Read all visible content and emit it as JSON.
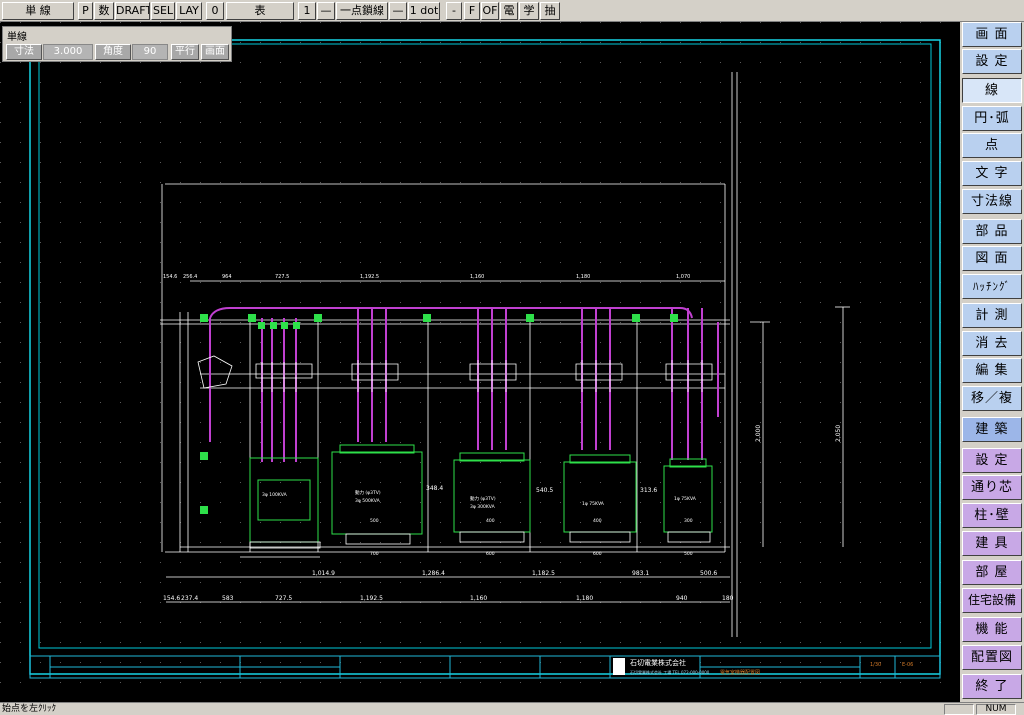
{
  "toolbar": {
    "items": [
      {
        "label": "単  線",
        "name": "line-type-button"
      },
      {
        "label": "P",
        "name": "p-button"
      },
      {
        "label": "数",
        "name": "number-button"
      },
      {
        "label": "DRAFT",
        "name": "draft-button"
      },
      {
        "label": "SEL",
        "name": "sel-button"
      },
      {
        "label": "LAY",
        "name": "layer-button"
      },
      {
        "label": "0",
        "name": "layer-number-button"
      },
      {
        "label": "表",
        "name": "table-button"
      },
      {
        "label": "1",
        "name": "line-number-button"
      },
      {
        "label": "—",
        "name": "line-sample-button"
      },
      {
        "label": "一点鎖線",
        "name": "linetype-button"
      },
      {
        "label": "—",
        "name": "line-width-sample-button"
      },
      {
        "label": "1 dot",
        "name": "line-width-button"
      },
      {
        "label": "-",
        "name": "minus-button"
      },
      {
        "label": "F",
        "name": "f-button"
      },
      {
        "label": "OF",
        "name": "of-button"
      },
      {
        "label": "電",
        "name": "electric-button"
      },
      {
        "label": "学",
        "name": "learn-button"
      },
      {
        "label": "抽",
        "name": "extract-button"
      }
    ]
  },
  "panel": {
    "title": "単線",
    "size_label": "寸法",
    "size_value": "3.000",
    "angle_label": "角度",
    "angle_value": "90",
    "parallel_label": "平行",
    "screen_label": "画面"
  },
  "menu": {
    "items": [
      {
        "label": "画 面",
        "name": "menu-screen",
        "style": "normal"
      },
      {
        "label": "設 定",
        "name": "menu-settings",
        "style": "normal"
      },
      {
        "label": "線",
        "name": "menu-line",
        "style": "active"
      },
      {
        "label": "円･弧",
        "name": "menu-circle-arc",
        "style": "normal"
      },
      {
        "label": "点",
        "name": "menu-point",
        "style": "normal"
      },
      {
        "label": "文 字",
        "name": "menu-text",
        "style": "normal"
      },
      {
        "label": "寸法線",
        "name": "menu-dimension",
        "style": "normal"
      },
      {
        "label": "部 品",
        "name": "menu-parts",
        "style": "normal"
      },
      {
        "label": "図 面",
        "name": "menu-drawing",
        "style": "normal"
      },
      {
        "label": "ﾊｯﾁﾝｸﾞ",
        "name": "menu-hatching",
        "style": "normal"
      },
      {
        "label": "計 測",
        "name": "menu-measure",
        "style": "normal"
      },
      {
        "label": "消 去",
        "name": "menu-erase",
        "style": "normal"
      },
      {
        "label": "編 集",
        "name": "menu-edit",
        "style": "normal"
      },
      {
        "label": "移／複",
        "name": "menu-move-copy",
        "style": "normal"
      },
      {
        "label": "建 築",
        "name": "menu-architecture",
        "style": "section"
      },
      {
        "label": "設 定",
        "name": "menu-arch-settings",
        "style": "arch"
      },
      {
        "label": "通り芯",
        "name": "menu-grid-lines",
        "style": "arch"
      },
      {
        "label": "柱･壁",
        "name": "menu-column-wall",
        "style": "arch"
      },
      {
        "label": "建 具",
        "name": "menu-fittings",
        "style": "arch"
      },
      {
        "label": "部 屋",
        "name": "menu-room",
        "style": "arch"
      },
      {
        "label": "住宅設備",
        "name": "menu-housing-equipment",
        "style": "arch"
      },
      {
        "label": "機 能",
        "name": "menu-function",
        "style": "arch"
      },
      {
        "label": "配置図",
        "name": "menu-layout",
        "style": "arch"
      },
      {
        "label": "終 了",
        "name": "menu-exit",
        "style": "arch"
      }
    ]
  },
  "drawing": {
    "dims_top": [
      "154.6",
      "256.4",
      "964",
      "727.5",
      "1,192.5",
      "1,160",
      "1,180",
      "1,070"
    ],
    "dims_mid": [
      "1,014.9",
      "1,286.4",
      "1,182.5",
      "983.1",
      "500.6"
    ],
    "dims_bottom": [
      "154.6",
      "237.4",
      "583",
      "727.5",
      "1,192.5",
      "1,160",
      "1,180",
      "940",
      "180"
    ],
    "transformer_labels": [
      {
        "line1": "動力 (φ3TV)",
        "line2": "3φ 500KVA",
        "base": "500",
        "foot": "700"
      },
      {
        "line1": "動力 (φ3TV)",
        "line2": "3φ 300KVA",
        "base": "400",
        "foot": "600"
      },
      {
        "line1": "1φ  75KVA",
        "line2": "",
        "base": "400",
        "foot": "600"
      },
      {
        "line1": "1φ  75KVA",
        "line2": "",
        "base": "300",
        "foot": "500"
      }
    ],
    "gap_labels": [
      "348.4",
      "540.5",
      "313.6"
    ],
    "small_label": "3φ 100KVA",
    "vdim_1": "2,000",
    "vdim_2": "2,050",
    "title_block_company": "石切電業株式会社",
    "title_block_sub": "石切電業株式会社 工場 TEL 072-000-0000",
    "title_block_title": "電気室機器配置図",
    "title_block_scale": "1/30",
    "title_block_sheet": "E-06"
  },
  "status": {
    "text": "始点を左ｸﾘｯｸ",
    "num": "NUM"
  }
}
